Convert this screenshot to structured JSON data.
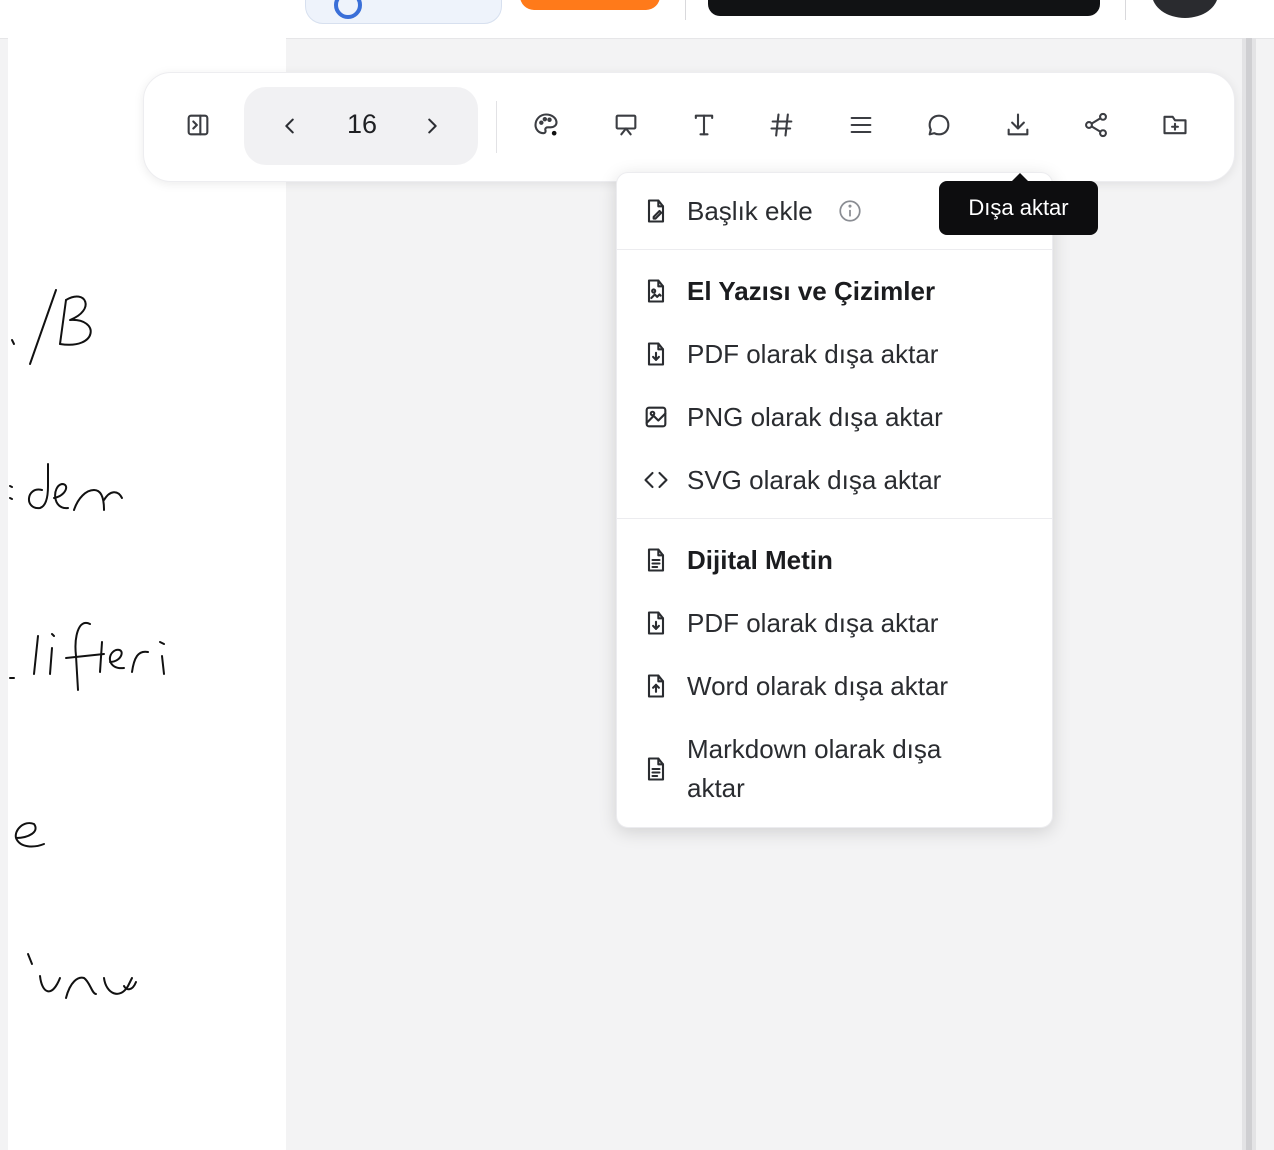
{
  "toolbar": {
    "page_number": "16",
    "icons": [
      "sidebar-toggle-icon",
      "chevron-left-icon",
      "chevron-right-icon",
      "palette-icon",
      "presentation-icon",
      "text-icon",
      "hash-icon",
      "menu-lines-icon",
      "comment-icon",
      "download-icon",
      "share-icon",
      "folder-plus-icon"
    ]
  },
  "tooltip": {
    "label": "Dışa aktar"
  },
  "menu": {
    "add_title": "Başlık ekle",
    "section1_title": "El Yazısı ve Çizimler",
    "section1_items": [
      "PDF olarak dışa aktar",
      "PNG olarak dışa aktar",
      "SVG olarak dışa aktar"
    ],
    "section2_title": "Dijital Metin",
    "section2_items": [
      "PDF olarak dışa aktar",
      "Word olarak dışa aktar",
      "Markdown olarak dışa aktar"
    ]
  },
  "colors": {
    "accent_orange": "#ff7a1a",
    "accent_blue": "#3a6fd8",
    "tooltip_bg": "#0d0d0f"
  }
}
